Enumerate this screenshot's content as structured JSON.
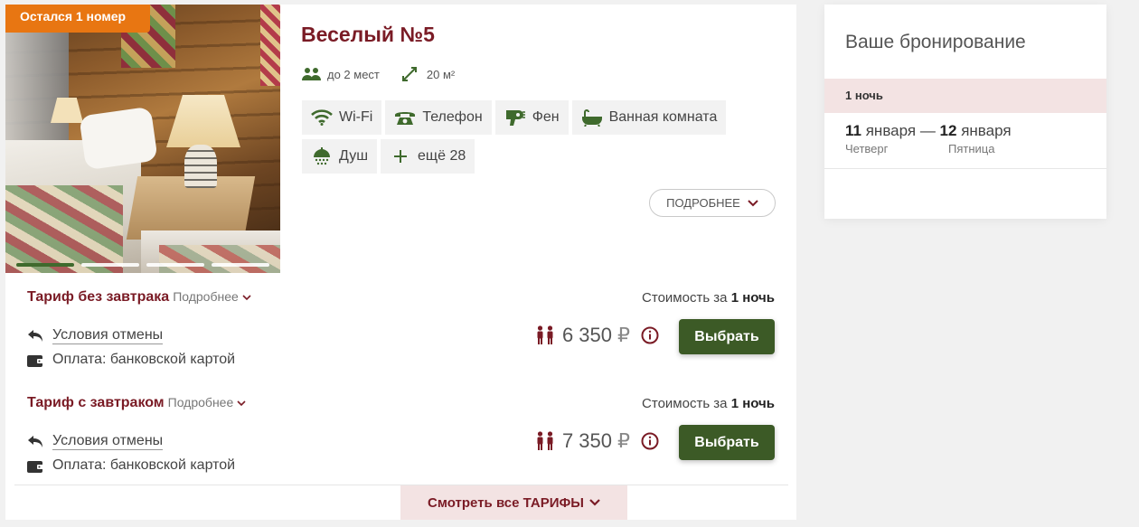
{
  "room": {
    "badge": "Остался 1 номер",
    "title": "Веселый №5",
    "capacity": "до 2 мест",
    "area": "20 м²",
    "amenities": [
      {
        "icon": "wifi-icon",
        "label": "Wi-Fi"
      },
      {
        "icon": "phone-icon",
        "label": "Телефон"
      },
      {
        "icon": "hairdryer-icon",
        "label": "Фен"
      },
      {
        "icon": "bathtub-icon",
        "label": "Ванная комната"
      },
      {
        "icon": "shower-icon",
        "label": "Душ"
      },
      {
        "icon": "plus-icon",
        "label": "ещё 28"
      }
    ],
    "more_label": "ПОДРОБНЕЕ",
    "photo_count": 4,
    "active_photo": 1
  },
  "tariffs": [
    {
      "name": "Тариф без завтрака",
      "details_label": "Подробнее",
      "cost_prefix": "Стоимость за",
      "cost_nights": "1 ночь",
      "cancel_label": "Условия отмены",
      "payment_label": "Оплата: банковской картой",
      "price": "6 350",
      "currency": "₽",
      "choose_label": "Выбрать"
    },
    {
      "name": "Тариф с завтраком",
      "details_label": "Подробнее",
      "cost_prefix": "Стоимость за",
      "cost_nights": "1 ночь",
      "cancel_label": "Условия отмены",
      "payment_label": "Оплата: банковской картой",
      "price": "7 350",
      "currency": "₽",
      "choose_label": "Выбрать"
    }
  ],
  "all_tariffs_label": "Смотреть все ТАРИФЫ",
  "booking": {
    "title": "Ваше бронирование",
    "nights": "1 ночь",
    "checkin_day": "11",
    "checkin_month": "января",
    "dash": "—",
    "checkout_day": "12",
    "checkout_month": "января",
    "checkin_weekday": "Четверг",
    "checkout_weekday": "Пятница"
  },
  "colors": {
    "accent": "#7a1b25",
    "button": "#3c5a26",
    "icon_green": "#3f6a2d",
    "badge": "#e87612",
    "highlight": "#f3e3e3"
  }
}
